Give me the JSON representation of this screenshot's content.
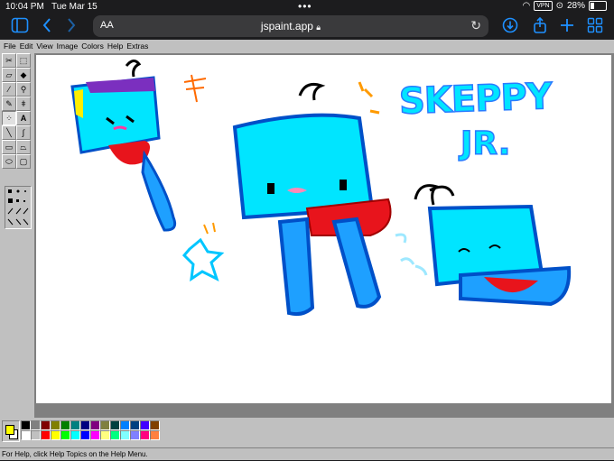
{
  "ios_status": {
    "time": "10:04 PM",
    "date": "Tue Mar 15",
    "vpn": "VPN",
    "battery": "28%"
  },
  "browser": {
    "aa_label": "AA",
    "url": "jspaint.app"
  },
  "menu": [
    "File",
    "Edit",
    "View",
    "Image",
    "Colors",
    "Help",
    "Extras"
  ],
  "tools": [
    "free-form-select",
    "select",
    "eraser",
    "fill",
    "pick-color",
    "magnifier",
    "pencil",
    "brush",
    "airbrush",
    "text",
    "line",
    "curve",
    "rectangle",
    "polygon",
    "ellipse",
    "rounded-rectangle"
  ],
  "colors": {
    "primary": "#ffff00",
    "secondary": "#ffffff",
    "palette_top": [
      "#000000",
      "#808080",
      "#800000",
      "#808000",
      "#008000",
      "#008080",
      "#000080",
      "#800080",
      "#808040",
      "#004040",
      "#0080ff",
      "#004080",
      "#4000ff",
      "#804000"
    ],
    "palette_bottom": [
      "#ffffff",
      "#c0c0c0",
      "#ff0000",
      "#ffff00",
      "#00ff00",
      "#00ffff",
      "#0000ff",
      "#ff00ff",
      "#ffff80",
      "#00ff80",
      "#80ffff",
      "#8080ff",
      "#ff0080",
      "#ff8040"
    ]
  },
  "drawing": {
    "title_line1": "SKEPPY",
    "title_line2": "JR."
  },
  "status_text": "For Help, click Help Topics on the Help Menu."
}
